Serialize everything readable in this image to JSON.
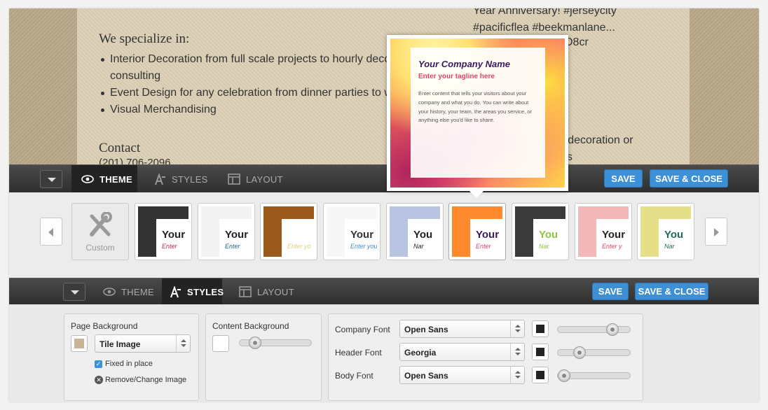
{
  "site": {
    "specialize_heading": "We specialize in:",
    "specialize_items": [
      "Interior Decoration from full scale projects to hourly deco",
      "consulting",
      "Event Design for any celebration from dinner parties to w",
      "Visual Merchandising"
    ],
    "contact_heading": "Contact",
    "phone": "(201) 706-2096",
    "tweet_lines": [
      "Year Anniversary! #jerseycity",
      "#pacificflea #beekmanlane..."
    ],
    "tweet_tail": "D8cr",
    "right_text_1": "ior decoration or",
    "right_text_2": "es"
  },
  "toolbar_top": {
    "tabs": [
      {
        "label": "THEME",
        "icon": "eye-icon",
        "active": true
      },
      {
        "label": "STYLES",
        "icon": "styles-icon",
        "active": false
      },
      {
        "label": "LAYOUT",
        "icon": "layout-icon",
        "active": false
      }
    ],
    "save": "SAVE",
    "save_close": "SAVE & CLOSE"
  },
  "preview_popup": {
    "company_name": "Your Company Name",
    "tagline": "Enter your tagline here",
    "body": "Enter content that tells your visitors about your company and what you do. You can write about your history, your team, the areas you service, or anything else you'd like to share."
  },
  "themes": {
    "custom_label": "Custom",
    "items": [
      {
        "title": "Your",
        "sub": "Enter",
        "bg": "#333",
        "title_color": "#222",
        "sub_color": "#c0284a"
      },
      {
        "title": "Your",
        "sub": "Enter",
        "bg": "#f3f3f3",
        "title_color": "#222",
        "sub_color": "#1f6a8a"
      },
      {
        "title": "Your",
        "sub": "Enter yo",
        "bg": "#9a5a1c",
        "title_color": "#fff",
        "sub_color": "#d9d37a"
      },
      {
        "title": "Your",
        "sub": "Enter you",
        "bg": "#f7f7f7",
        "title_color": "#333",
        "sub_color": "#3d8fd6"
      },
      {
        "title": "You",
        "sub": "Nar",
        "bg": "#b8c4e2",
        "title_color": "#222",
        "sub_color": "#222"
      },
      {
        "title": "Your",
        "sub": "Enter",
        "bg": "#ff8a2e",
        "title_color": "#3a1a5e",
        "sub_color": "#e0456a"
      },
      {
        "title": "You",
        "sub": "Nar",
        "bg": "#3a3a3a",
        "title_color": "#8cc63f",
        "sub_color": "#8cc63f"
      },
      {
        "title": "Your",
        "sub": "Enter y",
        "bg": "#f2b7b7",
        "title_color": "#222",
        "sub_color": "#e0456a"
      },
      {
        "title": "You",
        "sub": "Nar",
        "bg": "#e6df8a",
        "title_color": "#1f6a5a",
        "sub_color": "#1f6a5a"
      }
    ]
  },
  "toolbar_bottom": {
    "tabs": [
      {
        "label": "THEME",
        "icon": "eye-icon",
        "active": false
      },
      {
        "label": "STYLES",
        "icon": "styles-icon",
        "active": true
      },
      {
        "label": "LAYOUT",
        "icon": "layout-icon",
        "active": false
      }
    ],
    "save": "SAVE",
    "save_close": "SAVE & CLOSE"
  },
  "styles_panel": {
    "page_background": {
      "title": "Page Background",
      "color": "#c8b598",
      "mode": "Tile Image",
      "fixed_label": "Fixed in place",
      "fixed_checked": true,
      "remove_label": "Remove/Change Image"
    },
    "content_background": {
      "title": "Content Background",
      "color": "#ffffff",
      "opacity_level": 0.15
    },
    "fonts": [
      {
        "label": "Company Font",
        "font": "Open Sans",
        "color": "#222222",
        "size_level": 0.82
      },
      {
        "label": "Header Font",
        "font": "Georgia",
        "color": "#222222",
        "size_level": 0.28
      },
      {
        "label": "Body Font",
        "font": "Open Sans",
        "color": "#222222",
        "size_level": 0.02
      }
    ]
  }
}
